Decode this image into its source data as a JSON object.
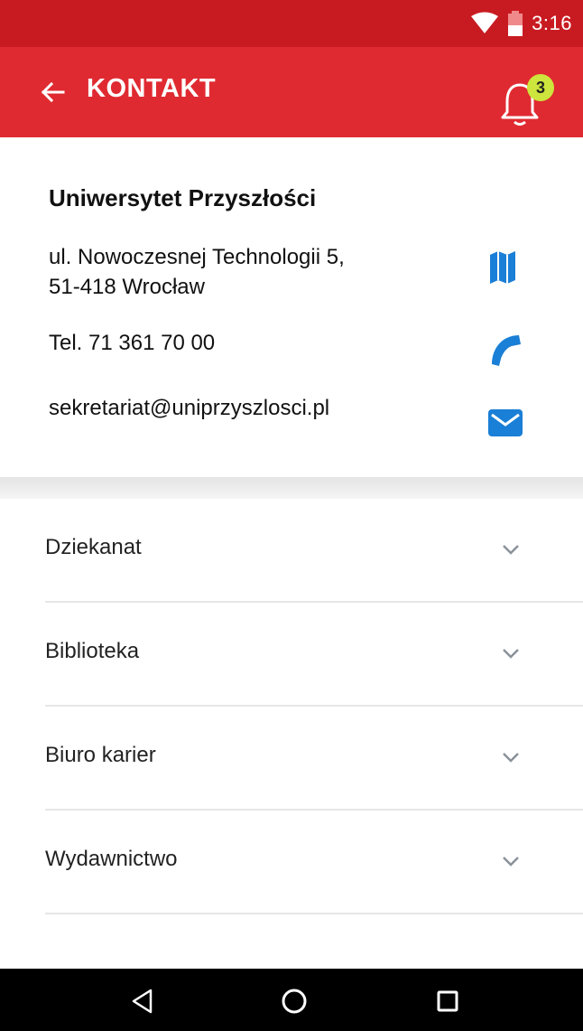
{
  "status_bar": {
    "time": "3:16",
    "background": "#c81b21"
  },
  "app_bar": {
    "title": "KONTAKT",
    "background": "#e02a31",
    "back_icon": "arrow-left-icon",
    "notification_icon": "bell-icon",
    "notification_count": "3",
    "badge_color": "#cde53c"
  },
  "contact": {
    "name": "Uniwersytet Przyszłości",
    "address_line1": "ul. Nowoczesnej Technologii 5,",
    "address_line2": "51-418 Wrocław",
    "phone": "Tel. 71 361 70 00",
    "email": "sekretariat@uniprzyszlosci.pl",
    "icon_color": "#1a7fd6",
    "icons": [
      "map-icon",
      "phone-icon",
      "mail-icon"
    ]
  },
  "sections": [
    {
      "label": "Dziekanat"
    },
    {
      "label": "Biblioteka"
    },
    {
      "label": "Biuro karier"
    },
    {
      "label": "Wydawnictwo"
    }
  ],
  "nav_bar": {
    "buttons": [
      "back-triangle-icon",
      "home-circle-icon",
      "recents-square-icon"
    ]
  }
}
